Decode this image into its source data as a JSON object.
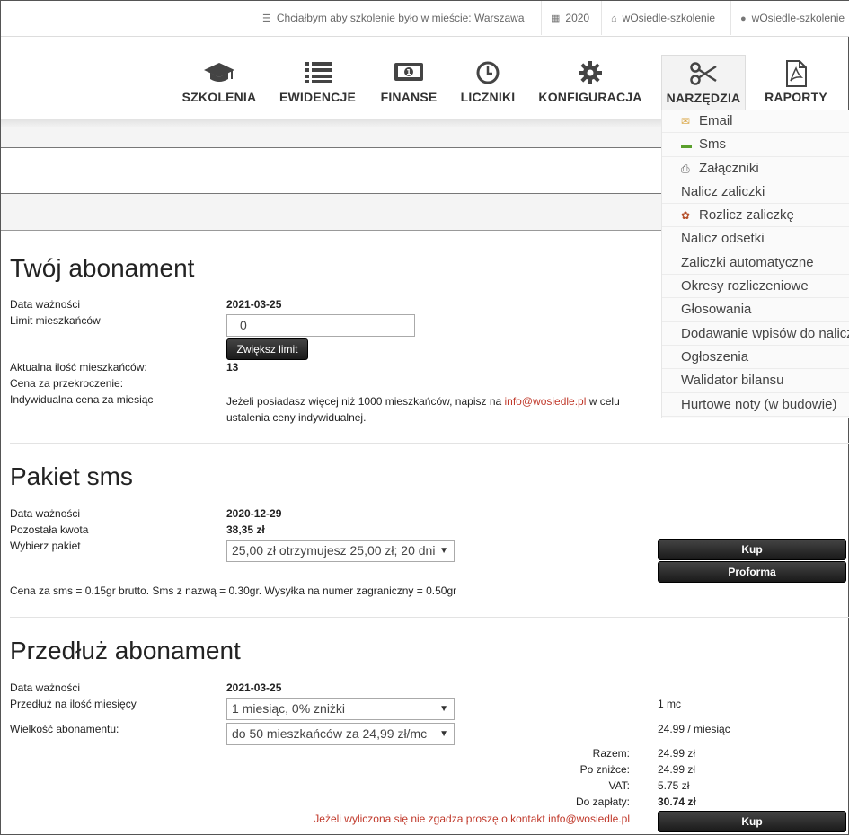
{
  "topbar": {
    "city": "Chciałbym aby szkolenie było w mieście: Warszawa",
    "year": "2020",
    "site": "wOsiedle-szkolenie",
    "user": "wOsiedle-szkolenie"
  },
  "nav": {
    "items": [
      {
        "label": "SZKOLENIA",
        "icon": "graduation-cap-icon"
      },
      {
        "label": "EWIDENCJE",
        "icon": "list-icon"
      },
      {
        "label": "FINANSE",
        "icon": "money-icon"
      },
      {
        "label": "LICZNIKI",
        "icon": "clock-icon"
      },
      {
        "label": "KONFIGURACJA",
        "icon": "gear-icon"
      },
      {
        "label": "NARZĘDZIA",
        "icon": "scissors-icon"
      },
      {
        "label": "RAPORTY",
        "icon": "pdf-icon"
      }
    ]
  },
  "dropdown": {
    "items": [
      {
        "label": "Email",
        "icon": "email-icon"
      },
      {
        "label": "Sms",
        "icon": "sms-icon"
      },
      {
        "label": "Załączniki",
        "icon": "attachment-icon"
      },
      {
        "label": "Nalicz zaliczki",
        "icon": ""
      },
      {
        "label": "Rozlicz zaliczkę",
        "icon": "settle-icon"
      },
      {
        "label": "Nalicz odsetki",
        "icon": ""
      },
      {
        "label": "Zaliczki automatyczne",
        "icon": ""
      },
      {
        "label": "Okresy rozliczeniowe",
        "icon": ""
      },
      {
        "label": "Głosowania",
        "icon": ""
      },
      {
        "label": "Dodawanie wpisów do naliczeń",
        "icon": ""
      },
      {
        "label": "Ogłoszenia",
        "icon": ""
      },
      {
        "label": "Walidator bilansu",
        "icon": ""
      },
      {
        "label": "Hurtowe noty (w budowie)",
        "icon": ""
      }
    ]
  },
  "subscription": {
    "title": "Twój abonament",
    "expiry_label": "Data ważności",
    "expiry_value": "2021-03-25",
    "limit_label": "Limit mieszkańców",
    "limit_value": "0",
    "increase_button": "Zwiększ limit",
    "current_count_label": "Aktualna ilość mieszkańców:",
    "current_count_value": "13",
    "overage_label": "Cena za przekroczenie:",
    "individual_label": "Indywidualna cena za miesiąc",
    "individual_text_1": "Jeżeli posiadasz więcej niż 1000 mieszkańców, napisz na ",
    "individual_email": "info@wosiedle.pl",
    "individual_text_2": " w celu",
    "individual_text_3": "ustalenia ceny indywidualnej."
  },
  "sms": {
    "title": "Pakiet sms",
    "expiry_label": "Data ważności",
    "expiry_value": "2020-12-29",
    "remaining_label": "Pozostała kwota",
    "remaining_value": "38,35 zł",
    "package_label": "Wybierz pakiet",
    "package_selected": "25,00 zł otrzymujesz 25,00 zł; 20 dni",
    "buy_button": "Kup",
    "proforma_button": "Proforma",
    "price_info": "Cena za sms = 0.15gr brutto. Sms z nazwą = 0.30gr. Wysyłka na numer zagraniczny = 0.50gr"
  },
  "extend": {
    "title": "Przedłuż abonament",
    "expiry_label": "Data ważności",
    "expiry_value": "2021-03-25",
    "months_label": "Przedłuż na ilość miesięcy",
    "months_selected": "1 miesiąc, 0% zniżki",
    "months_summary": "1 mc",
    "size_label": "Wielkość abonamentu:",
    "size_selected": "do 50 mieszkańców za 24,99 zł/mc",
    "size_summary": "24.99 / miesiąc",
    "total_label": "Razem:",
    "total_value": "24.99 zł",
    "discount_label": "Po zniżce:",
    "discount_value": "24.99 zł",
    "vat_label": "VAT:",
    "vat_value": "5.75 zł",
    "pay_label": "Do zapłaty:",
    "pay_value": "30.74 zł",
    "contact_text": "Jeżeli wyliczona się nie zgadza proszę o kontakt info@wosiedle.pl",
    "buy_button": "Kup"
  }
}
